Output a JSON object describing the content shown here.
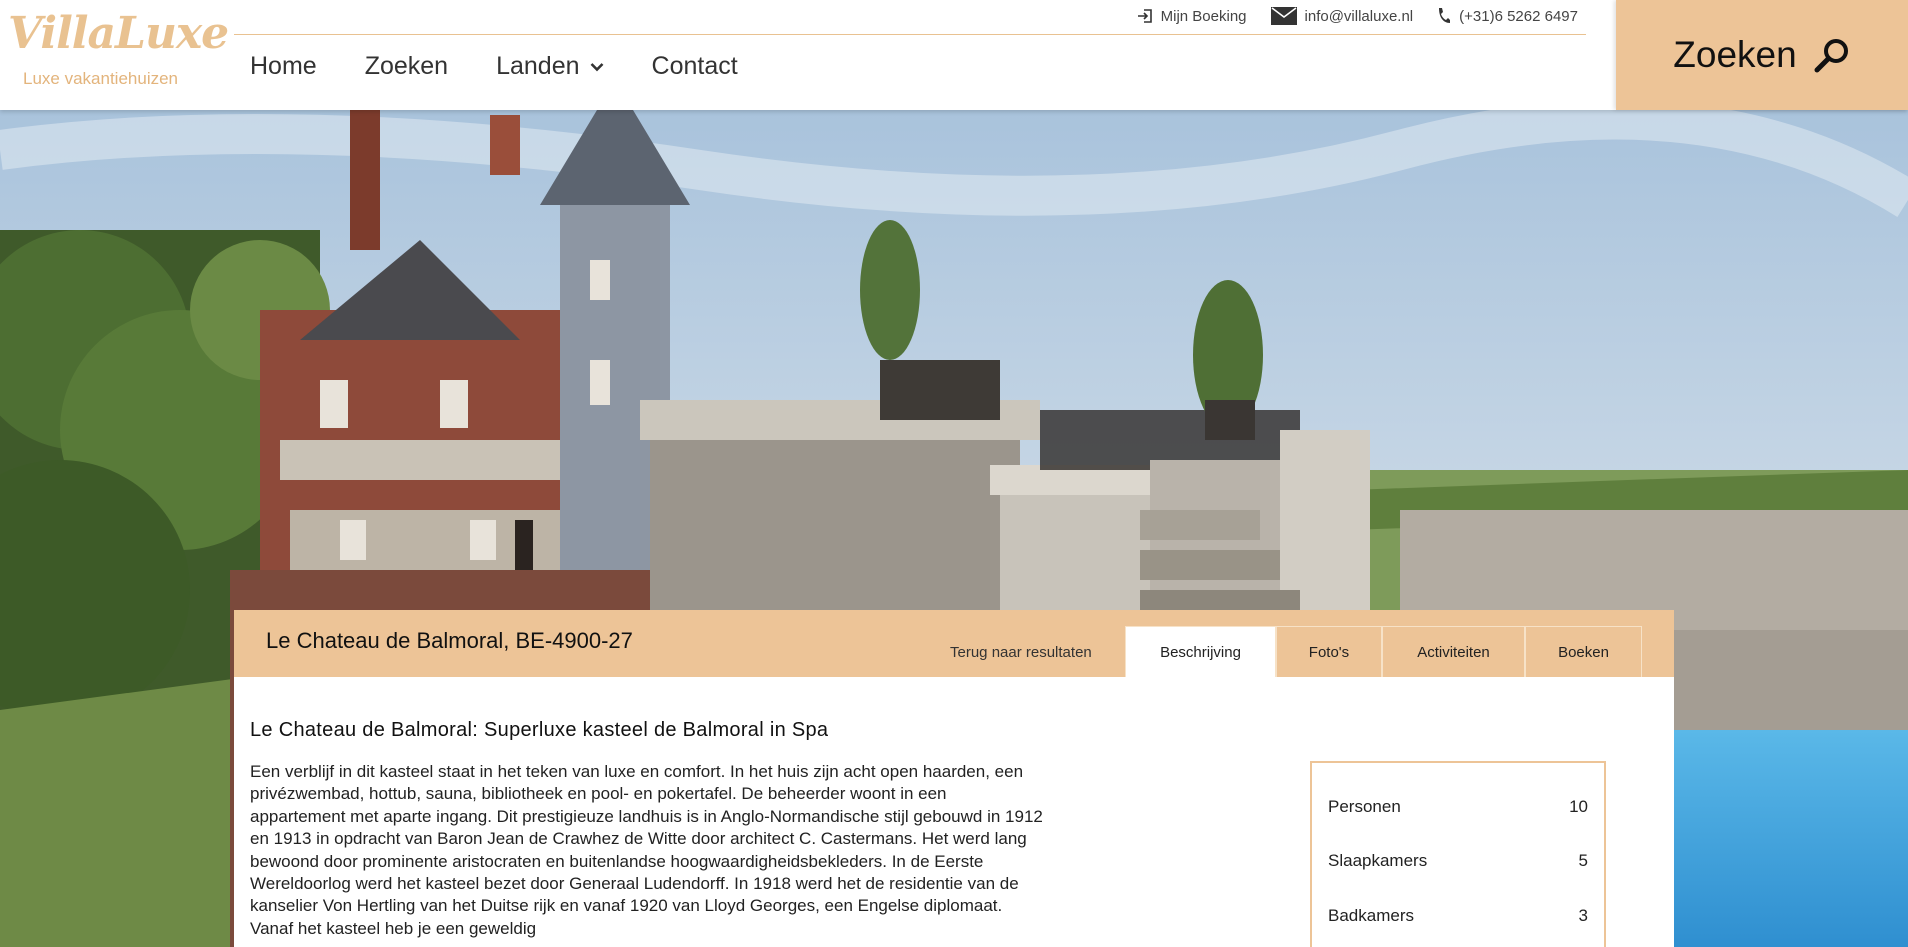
{
  "brand": {
    "logo_text": "VillaLuxe",
    "tagline": "Luxe vakantiehuizen",
    "accent_color": "#edc497"
  },
  "topbar": {
    "booking": "Mijn Boeking",
    "email": "info@villaluxe.nl",
    "phone": "(+31)6 5262 6497",
    "booking_icon": "login-icon",
    "email_icon": "envelope-icon",
    "phone_icon": "phone-icon"
  },
  "nav": {
    "items": [
      {
        "label": "Home"
      },
      {
        "label": "Zoeken"
      },
      {
        "label": "Landen",
        "icon": "chevron-down-icon"
      },
      {
        "label": "Contact"
      }
    ]
  },
  "search_button": {
    "label": "Zoeken",
    "icon": "search-icon"
  },
  "property": {
    "title": "Le Chateau de Balmoral, BE-4900-27",
    "back_link": "Terug naar resultaten",
    "tabs": [
      {
        "label": "Beschrijving",
        "active": true
      },
      {
        "label": "Foto's",
        "active": false
      },
      {
        "label": "Activiteiten",
        "active": false
      },
      {
        "label": "Boeken",
        "active": false
      }
    ],
    "heading": "Le Chateau de Balmoral: Superluxe kasteel de Balmoral in Spa",
    "description": "Een verblijf in dit kasteel staat in het teken van luxe en comfort. In het huis zijn acht open haarden, een privézwembad, hottub, sauna, bibliotheek en pool- en pokertafel. De beheerder woont in een appartement met aparte ingang. Dit prestigieuze landhuis is in Anglo-Normandische stijl gebouwd in 1912 en 1913 in opdracht van Baron Jean de Crawhez de Witte door architect C. Castermans. Het werd lang bewoond door prominente aristocraten en buitenlandse hoogwaardigheidsbekleders. In de Eerste Wereldoorlog werd het kasteel bezet door Generaal Ludendorff. In 1918 werd het de residentie van de kanselier Von Hertling van het Duitse rijk en vanaf 1920 van Lloyd Georges, een Engelse diplomaat. Vanaf het kasteel heb je een geweldig",
    "specs": [
      {
        "label": "Personen",
        "value": "10"
      },
      {
        "label": "Slaapkamers",
        "value": "5"
      },
      {
        "label": "Badkamers",
        "value": "3"
      }
    ]
  }
}
